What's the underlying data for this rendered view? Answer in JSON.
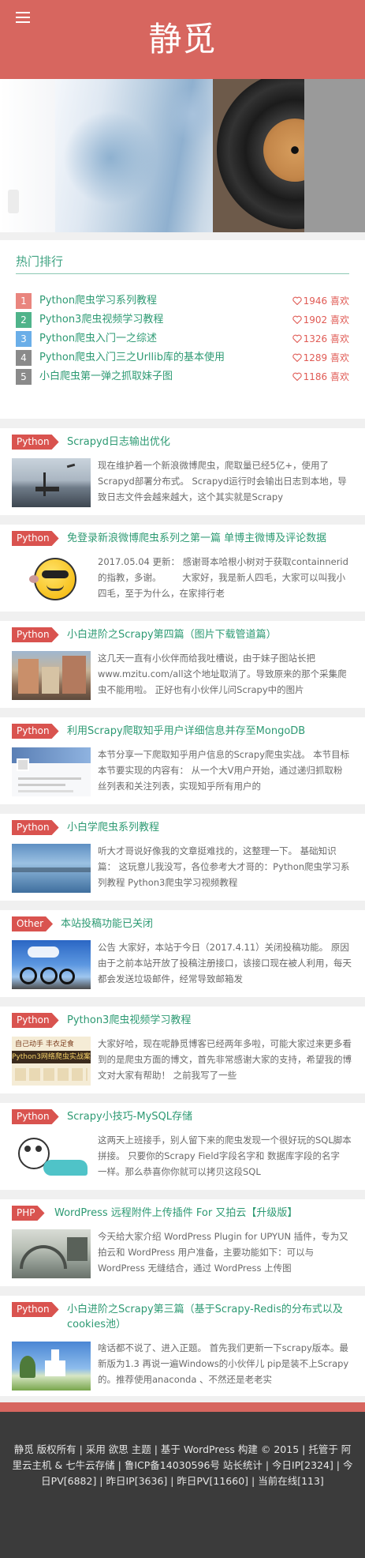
{
  "site": {
    "title": "静觅"
  },
  "hot": {
    "heading": "热门排行",
    "items": [
      {
        "rank": "1",
        "title": "Python爬虫学习系列教程",
        "likes": "1946 喜欢",
        "color": "#e9857e"
      },
      {
        "rank": "2",
        "title": "Python3爬虫视频学习教程",
        "likes": "1902 喜欢",
        "color": "#4fb38a"
      },
      {
        "rank": "3",
        "title": "Python爬虫入门一之综述",
        "likes": "1326 喜欢",
        "color": "#6aaee8"
      },
      {
        "rank": "4",
        "title": "Python爬虫入门三之Urllib库的基本使用",
        "likes": "1289 喜欢",
        "color": "#8a8a8a"
      },
      {
        "rank": "5",
        "title": "小白爬虫第一弹之抓取妹子图",
        "likes": "1186 喜欢",
        "color": "#8a8a8a"
      }
    ]
  },
  "posts": [
    {
      "tag": "Python",
      "title": "Scrapyd日志输出优化",
      "excerpt": "现在维护着一个新浪微博爬虫，爬取量已经5亿+，使用了Scrapyd部署分布式。 Scrapyd运行时会输出日志到本地，导致日志文件会越来越大，这个其实就是Scrapy",
      "thumb": "harbor-photo"
    },
    {
      "tag": "Python",
      "title": "免登录新浪微博爬虫系列之第一篇 单博主微博及评论数据",
      "excerpt": "2017.05.04 更新： 感谢哥本哈根小树对于获取containnerid的指教，多谢。 　　大家好，我是新人四毛，大家可以叫我小四毛，至于为什么，在家排行老",
      "thumb": "cartoon-face"
    },
    {
      "tag": "Python",
      "title": "小白进阶之Scrapy第四篇（图片下载管道篇）",
      "excerpt": "这几天一直有小伙伴而给我吐槽说，由于妹子图站长把www.mzitu.com/all这个地址取消了。导致原来的那个采集爬虫不能用啦。 正好也有小伙伴儿问Scrapy中的图片",
      "thumb": "street-photo"
    },
    {
      "tag": "Python",
      "title": "利用Scrapy爬取知乎用户详细信息并存至MongoDB",
      "excerpt": "本节分享一下爬取知乎用户信息的Scrapy爬虫实战。 本节目标 本节要实现的内容有： 从一个大V用户开始，通过递归抓取粉丝列表和关注列表，实现知乎所有用户的",
      "thumb": "profile-screenshot"
    },
    {
      "tag": "Python",
      "title": "小白学爬虫系列教程",
      "excerpt": "听大才哥说好像我的文章挺难找的，这整理一下。 基础知识篇： 这玩意儿我没写，各位参考大才哥的：Python爬虫学习系列教程 Python3爬虫学习视频教程",
      "thumb": "lake-photo"
    },
    {
      "tag": "Other",
      "title": "本站投稿功能已关闭",
      "excerpt": "公告 大家好，本站于今日（2017.4.11）关闭投稿功能。 原因 由于之前本站开放了投稿注册接口，该接口现在被人利用，每天都会发送垃圾邮件，经常导致邮箱发",
      "thumb": "bikes-photo"
    },
    {
      "tag": "Python",
      "title": "Python3爬虫视频学习教程",
      "excerpt": "大家好哈，现在呢静觅博客已经两年多啦，可能大家过来更多看到的是爬虫方面的博文，首先非常感谢大家的支持，希望我的博文对大家有帮助！ 之前我写了一些",
      "thumb": "course-cover"
    },
    {
      "tag": "Python",
      "title": "Scrapy小技巧-MySQL存储",
      "excerpt": "这两天上班接手，别人留下来的爬虫发现一个很好玩的SQL脚本拼接。 只要你的Scrapy Field字段名字和 数据库字段的名字 一样。那么恭喜你你就可以拷贝这段SQL",
      "thumb": "doodle"
    },
    {
      "tag": "PHP",
      "title": "WordPress 远程附件上传插件 For 又拍云【升级版】",
      "excerpt": "今天给大家介绍 WordPress Plugin for UPYUN 插件，专为又拍云和 WordPress 用户准备，主要功能如下：可以与 WordPress 无缝结合，通过 WordPress 上传图",
      "thumb": "bridge-photo"
    },
    {
      "tag": "Python",
      "title": "小白进阶之Scrapy第三篇（基于Scrapy-Redis的分布式以及cookies池）",
      "excerpt": "啥话都不说了、进入正题。 首先我们更新一下scrapy版本。最新版为1.3 再说一遍Windows的小伙伴儿 pip是装不上Scrapy的。推荐使用anaconda 、不然还是老老实",
      "thumb": "church-photo"
    }
  ],
  "course_cover": {
    "line1": "自己动手 丰衣足食",
    "line2": "Python3网络爬虫实战案例"
  },
  "footer": {
    "line": "静觅 版权所有 | 采用 欲思 主题 | 基于 WordPress 构建 © 2015 | 托管于 阿里云主机 & 七牛云存储 | 鲁ICP备14030596号 站长统计 | 今日IP[2324] | 今日PV[6882] | 昨日IP[3636] | 昨日PV[11660] | 当前在线[113]"
  },
  "colors": {
    "brand": "#d7665f",
    "link": "#2d9a73",
    "tag": "#d9534f"
  }
}
